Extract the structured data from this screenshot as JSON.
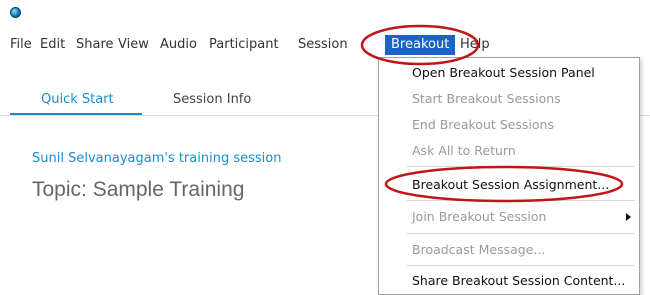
{
  "menubar": {
    "items": [
      {
        "label": "File"
      },
      {
        "label": "Edit"
      },
      {
        "label": "Share"
      },
      {
        "label": "View"
      },
      {
        "label": "Audio"
      },
      {
        "label": "Participant"
      },
      {
        "label": "Session"
      },
      {
        "label": "Breakout"
      },
      {
        "label": "Help"
      }
    ]
  },
  "tabs": [
    {
      "label": "Quick Start"
    },
    {
      "label": "Session Info"
    }
  ],
  "main": {
    "session_name": "Sunil Selvanayagam's training session",
    "topic": "Topic:  Sample Training"
  },
  "breakout_menu": {
    "items": [
      {
        "label": "Open Breakout Session Panel"
      },
      {
        "label": "Start Breakout Sessions"
      },
      {
        "label": "End Breakout Sessions"
      },
      {
        "label": "Ask All to Return"
      },
      {
        "label": "Breakout Session Assignment..."
      },
      {
        "label": "Join Breakout Session"
      },
      {
        "label": "Broadcast Message..."
      },
      {
        "label": "Share Breakout Session Content..."
      }
    ]
  },
  "colors": {
    "accent": "#1a8bd3",
    "menu_highlight": "#1a63c9",
    "annotation_red": "#c0161a"
  }
}
